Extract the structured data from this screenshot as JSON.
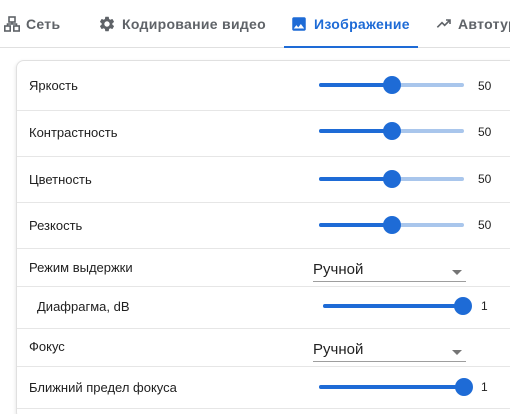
{
  "tabs": [
    {
      "label": "Сеть",
      "icon": "network-icon"
    },
    {
      "label": "Кодирование видео",
      "icon": "gear-icon"
    },
    {
      "label": "Изображение",
      "icon": "image-icon"
    },
    {
      "label": "Автотур",
      "icon": "trend-icon"
    }
  ],
  "active_tab": "Изображение",
  "accent_color": "#1e6bd6",
  "rows": {
    "brightness": {
      "label": "Яркость",
      "value": 50,
      "max": 100
    },
    "contrast": {
      "label": "Контрастность",
      "value": 50,
      "max": 100
    },
    "saturation": {
      "label": "Цветность",
      "value": 50,
      "max": 100
    },
    "sharpness": {
      "label": "Резкость",
      "value": 50,
      "max": 100
    },
    "exposure_mode": {
      "label": "Режим выдержки",
      "value": "Ручной"
    },
    "iris": {
      "label": "Диафрагма, dB",
      "value": 1,
      "max": 1
    },
    "focus": {
      "label": "Фокус",
      "value": "Ручной"
    },
    "focus_near_limit": {
      "label": "Ближний предел фокуса",
      "value": 1,
      "max": 1
    }
  }
}
